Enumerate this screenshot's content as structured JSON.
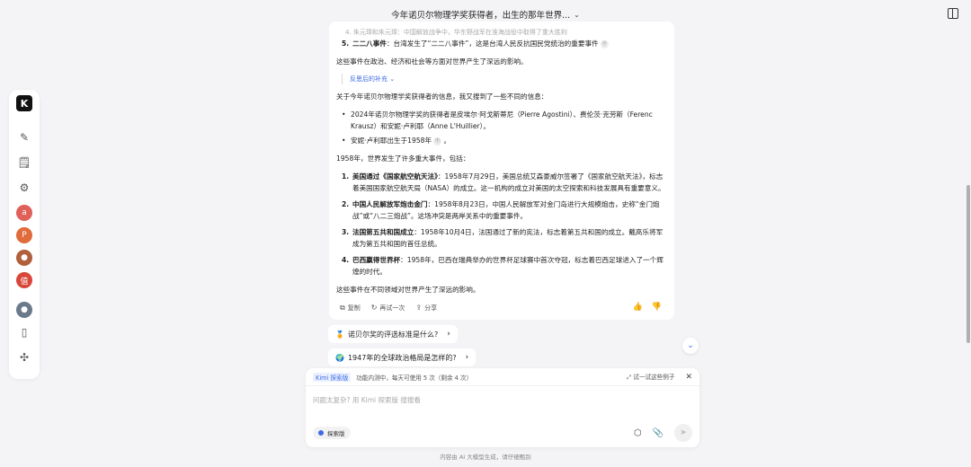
{
  "header": {
    "title": "今年诺贝尔物理学奖获得者，出生的那年世界...",
    "chevron": "⌄"
  },
  "rail": {
    "logo": "K",
    "icons": [
      "new-chat-icon",
      "history-icon",
      "explore-icon"
    ],
    "avatars": [
      {
        "name": "avatar-1",
        "color": "#e0605a",
        "text": "a"
      },
      {
        "name": "avatar-2",
        "color": "#e06b3b",
        "text": "P"
      },
      {
        "name": "avatar-3",
        "color": "#b0603c",
        "text": "🐱"
      },
      {
        "name": "avatar-4",
        "color": "#d9463a",
        "text": "值"
      },
      {
        "name": "avatar-5",
        "color": "#6b7a8b",
        "text": "⛰"
      }
    ]
  },
  "answer": {
    "faded_top": "4. 朱元璋和朱元璋：中国解放战争中，华东野战军在淮海战役中取得了重大胜利",
    "item5_title": "二二八事件",
    "item5_text": "：台湾发生了“二二八事件”，这是台湾人民反抗国民党统治的重要事件",
    "summary1": "这些事件在政治、经济和社会等方面对世界产生了深远的影响。",
    "supplement": "反思后的补充  ⌄",
    "intro": "关于今年诺贝尔物理学奖获得者的信息，我又搜到了一些不同的信息：",
    "bullet1": "2024年诺贝尔物理学奖的获得者是皮埃尔·阿戈斯蒂尼（Pierre Agostini）、费伦茨·克劳斯（Ferenc Krausz）和安妮·卢利耶（Anne L'Huillier）。",
    "bullet2": "安妮·卢利耶出生于1958年",
    "intro2": "1958年，世界发生了许多重大事件，包括：",
    "events": [
      {
        "n": "1.",
        "title": "美国通过《国家航空航天法》",
        "text": "：1958年7月29日，美国总统艾森豪威尔签署了《国家航空航天法》，标志着美国国家航空航天局（NASA）的成立。这一机构的成立对美国的太空探索和科技发展具有重要意义。"
      },
      {
        "n": "2.",
        "title": "中国人民解放军炮击金门",
        "text": "：1958年8月23日，中国人民解放军对金门岛进行大规模炮击，史称“金门炮战”或“八二三炮战”。这场冲突是两岸关系中的重要事件。"
      },
      {
        "n": "3.",
        "title": "法国第五共和国成立",
        "text": "：1958年10月4日，法国通过了新的宪法，标志着第五共和国的成立。戴高乐将军成为第五共和国的首任总统。"
      },
      {
        "n": "4.",
        "title": "巴西赢得世界杯",
        "text": "：1958年，巴西在瑞典举办的世界杯足球赛中首次夺冠，标志着巴西足球进入了一个辉煌的时代。"
      }
    ],
    "summary2": "这些事件在不同领域对世界产生了深远的影响。",
    "actions": {
      "copy": "复制",
      "retry": "再试一次",
      "share": "分享"
    }
  },
  "suggestions": [
    {
      "emoji": "🏅",
      "text": "诺贝尔奖的评选标准是什么?"
    },
    {
      "emoji": "🌍",
      "text": "1947年的全球政治格局是怎样的?"
    }
  ],
  "input": {
    "tag": "Kimi 探索版",
    "notice": "功能内测中，每天可使用 5 次（剩余 4 次）",
    "try_example": "试一试这些例子",
    "placeholder": "问题太复杂? 用 Kimi 探索版 搜搜看",
    "mode": "探索版"
  },
  "footer": "内容由 AI 大模型生成，请仔细甄别"
}
